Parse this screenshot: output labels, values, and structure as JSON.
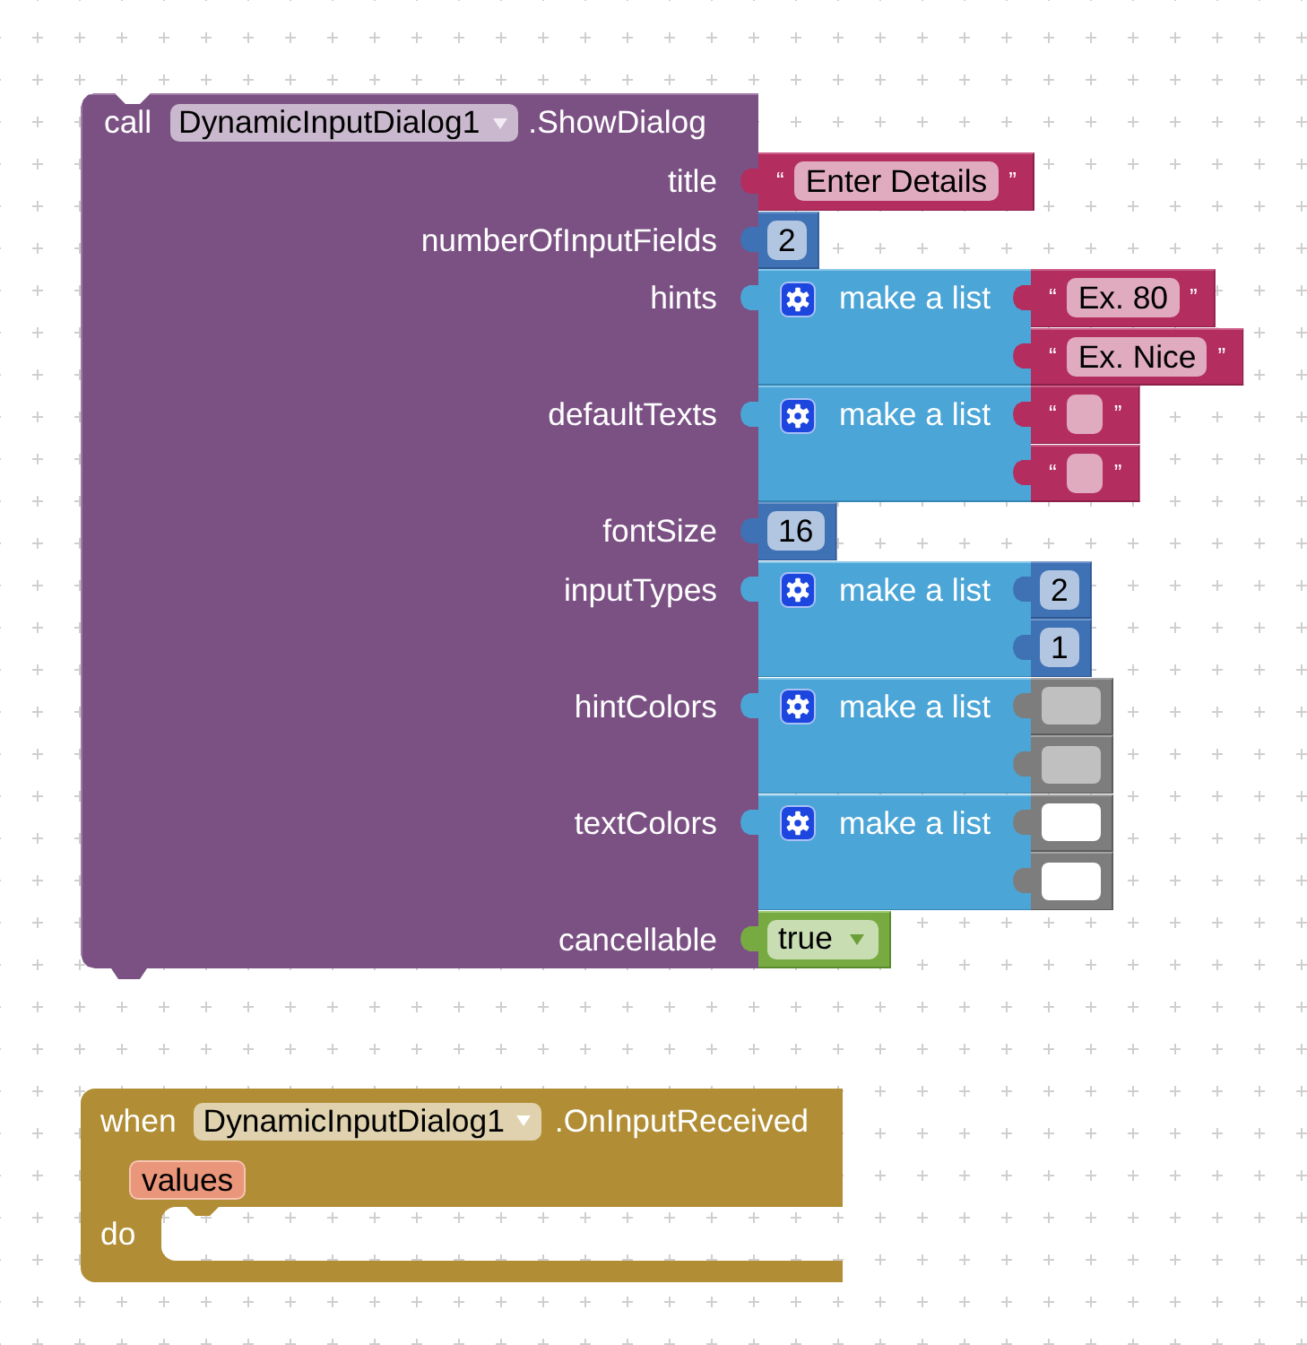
{
  "blocks": [
    {
      "kind": "method_call",
      "keyword": "call",
      "component": "DynamicInputDialog1",
      "method": ".ShowDialog",
      "args": [
        {
          "name": "title",
          "value": {
            "kind": "text",
            "open": "“",
            "text": "Enter Details",
            "close": "”"
          }
        },
        {
          "name": "numberOfInputFields",
          "value": {
            "kind": "number",
            "text": "2"
          }
        },
        {
          "name": "hints",
          "value": {
            "kind": "list",
            "label": "make a list",
            "items": [
              {
                "kind": "text",
                "open": "“",
                "text": "Ex. 80",
                "close": "”"
              },
              {
                "kind": "text",
                "open": "“",
                "text": "Ex. Nice",
                "close": "”"
              }
            ]
          }
        },
        {
          "name": "defaultTexts",
          "value": {
            "kind": "list",
            "label": "make a list",
            "items": [
              {
                "kind": "text",
                "open": "“",
                "close": "”"
              },
              {
                "kind": "text",
                "open": "“",
                "close": "”"
              }
            ]
          }
        },
        {
          "name": "fontSize",
          "value": {
            "kind": "number",
            "text": "16"
          }
        },
        {
          "name": "inputTypes",
          "value": {
            "kind": "list",
            "label": "make a list",
            "items": [
              {
                "kind": "number",
                "text": "2"
              },
              {
                "kind": "number",
                "text": "1"
              }
            ]
          }
        },
        {
          "name": "hintColors",
          "value": {
            "kind": "list",
            "label": "make a list",
            "items": [
              {
                "kind": "color",
                "color": "#c0c0c0"
              },
              {
                "kind": "color",
                "color": "#c0c0c0"
              }
            ]
          }
        },
        {
          "name": "textColors",
          "value": {
            "kind": "list",
            "label": "make a list",
            "items": [
              {
                "kind": "color",
                "color": "#ffffff"
              },
              {
                "kind": "color",
                "color": "#ffffff"
              }
            ]
          }
        },
        {
          "name": "cancellable",
          "value": {
            "kind": "logic",
            "text": "true"
          }
        }
      ]
    },
    {
      "kind": "event",
      "keyword": "when",
      "component": "DynamicInputDialog1",
      "event": ".OnInputReceived",
      "params": [
        "values"
      ],
      "do_label": "do"
    }
  ]
}
